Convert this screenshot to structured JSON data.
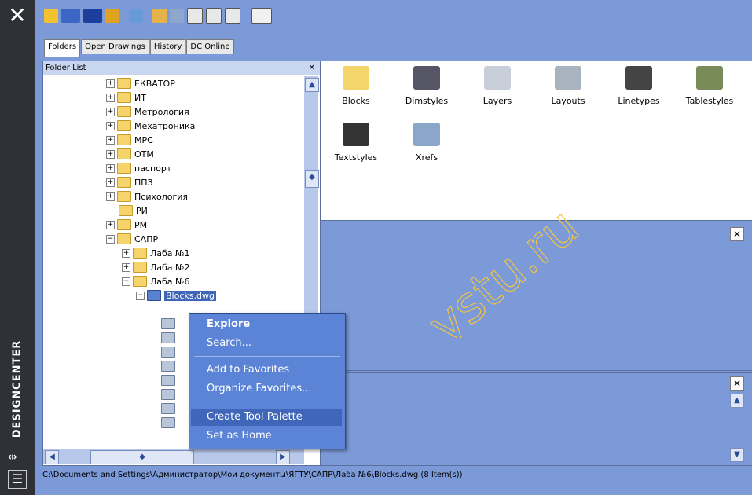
{
  "sidebar": {
    "title": "DESIGNCENTER",
    "close_glyph": "✕",
    "autohide_glyph": "⇹",
    "properties_glyph": "☰"
  },
  "toolbar": {
    "icons": [
      "load-icon",
      "back-icon",
      "forward-icon",
      "up-icon",
      "search-icon",
      "favorites-icon",
      "home-icon",
      "tree-view-toggle-icon",
      "preview-icon",
      "description-icon",
      "views-icon"
    ]
  },
  "tabs": [
    "Folders",
    "Open Drawings",
    "History",
    "DC Online"
  ],
  "folder_list": {
    "header": "Folder List",
    "items": [
      {
        "label": "ЕКВАТОР",
        "expanded": false
      },
      {
        "label": "ИТ",
        "expanded": false
      },
      {
        "label": "Метрология",
        "expanded": false
      },
      {
        "label": "Мехатроника",
        "expanded": false
      },
      {
        "label": "МРС",
        "expanded": false
      },
      {
        "label": "ОТМ",
        "expanded": false
      },
      {
        "label": "паспорт",
        "expanded": false
      },
      {
        "label": "ППЗ",
        "expanded": false
      },
      {
        "label": "Психология",
        "expanded": false
      },
      {
        "label": "РИ",
        "expanded": false
      },
      {
        "label": "РМ",
        "expanded": false
      },
      {
        "label": "САПР",
        "expanded": true
      },
      {
        "label": "Лаба №1",
        "expanded": false
      },
      {
        "label": "Лаба №2",
        "expanded": false
      },
      {
        "label": "Лаба №6",
        "expanded": true
      },
      {
        "label": "Blocks.dwg",
        "expanded": true
      }
    ]
  },
  "content_items": [
    "Blocks",
    "Dimstyles",
    "Layers",
    "Layouts",
    "Linetypes",
    "Tablestyles",
    "Textstyles",
    "Xrefs"
  ],
  "context_menu": {
    "items": [
      "Explore",
      "Search...",
      "Add to Favorites",
      "Organize Favorites...",
      "Create Tool Palette",
      "Set as Home"
    ],
    "highlighted": "Create Tool Palette"
  },
  "status_bar": {
    "path": "C:\\Documents and Settings\\Администратор\\Мои документы\\ЯГТУ\\САПР\\Лаба №6\\Blocks.dwg (8 Item(s))"
  },
  "watermark": {
    "text": "ms.ystu.ru"
  },
  "colors": {
    "panel_bg": "#7c9ad8",
    "menu_bg": "#5b84d6",
    "sidebar": "#2f3136"
  }
}
